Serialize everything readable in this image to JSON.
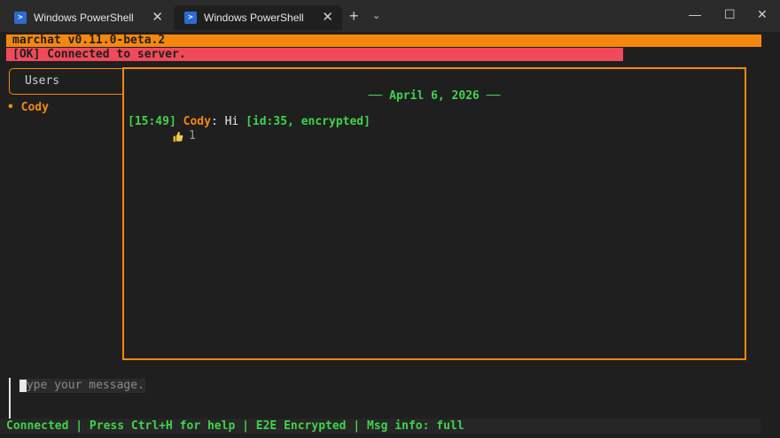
{
  "window": {
    "tabs": [
      {
        "label": "Windows PowerShell",
        "icon": "powershell-icon",
        "active": false
      },
      {
        "label": "Windows PowerShell",
        "icon": "powershell-icon",
        "active": true
      }
    ],
    "new_tab_glyph": "+",
    "dropdown_glyph": "⌄",
    "minimize_glyph": "—",
    "maximize_glyph": "☐",
    "close_glyph": "✕",
    "tab_close_glyph": "✕"
  },
  "app": {
    "header": "marchat v0.11.0-beta.2",
    "status": "[OK] Connected to server."
  },
  "sidebar": {
    "title": "Users",
    "users": [
      {
        "bullet": "•",
        "name": "Cody"
      }
    ]
  },
  "chat": {
    "date_separator": "── April 6, 2026 ──",
    "messages": [
      {
        "time": "[15:49]",
        "user": "Cody",
        "separator": ": ",
        "text": "Hi ",
        "meta": "[id:35, encrypted]",
        "reaction": {
          "icon": "thumbs-up-icon",
          "count": "1"
        }
      }
    ]
  },
  "input": {
    "placeholder": "Type your message..."
  },
  "footer": {
    "text": "Connected | Press Ctrl+H for help | E2E Encrypted | Msg info: full"
  },
  "colors": {
    "accent_orange": "#f5870f",
    "status_red": "#f04a5a",
    "text_green": "#3fd34d",
    "background": "#1f1f1f",
    "titlebar": "#2b2b2b"
  }
}
